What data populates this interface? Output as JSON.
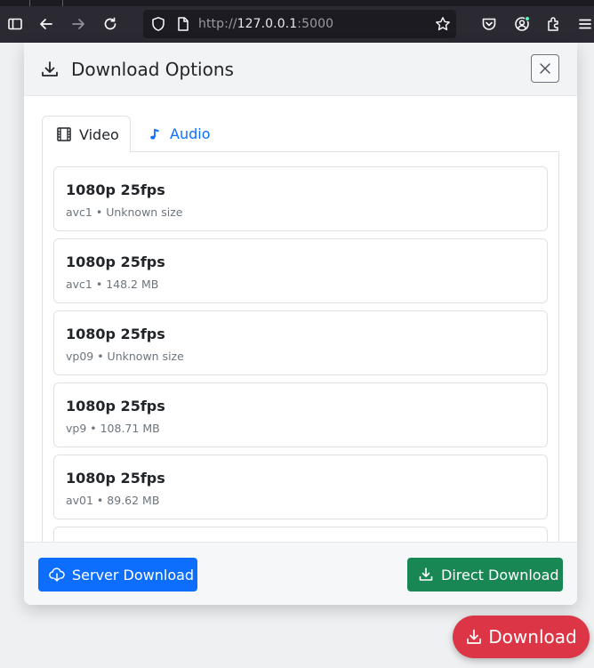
{
  "browser": {
    "url_scheme": "http://",
    "url_host": "127.0.0.1",
    "url_port": ":5000",
    "icons": [
      "sidebar-icon",
      "back-icon",
      "forward-icon",
      "reload-icon",
      "shield-icon",
      "page-icon",
      "star-icon",
      "pocket-icon",
      "account-icon",
      "extensions-icon",
      "menu-icon"
    ]
  },
  "modal": {
    "title": "Download Options",
    "tabs": [
      {
        "label": "Video",
        "icon": "film-icon",
        "active": true
      },
      {
        "label": "Audio",
        "icon": "music-note-icon",
        "active": false
      }
    ],
    "formats": [
      {
        "resolution": "1080p 25fps",
        "meta": "avc1 • Unknown size"
      },
      {
        "resolution": "1080p 25fps",
        "meta": "avc1 • 148.2 MB"
      },
      {
        "resolution": "1080p 25fps",
        "meta": "vp09 • Unknown size"
      },
      {
        "resolution": "1080p 25fps",
        "meta": "vp9 • 108.71 MB"
      },
      {
        "resolution": "1080p 25fps",
        "meta": "av01 • 89.62 MB"
      }
    ],
    "footer": {
      "server_download": "Server Download",
      "direct_download": "Direct Download"
    }
  },
  "fab": {
    "label": "Download"
  },
  "colors": {
    "primary": "#0d6efd",
    "success": "#198754",
    "danger": "#dc3545",
    "chrome": "#2b2a33"
  }
}
